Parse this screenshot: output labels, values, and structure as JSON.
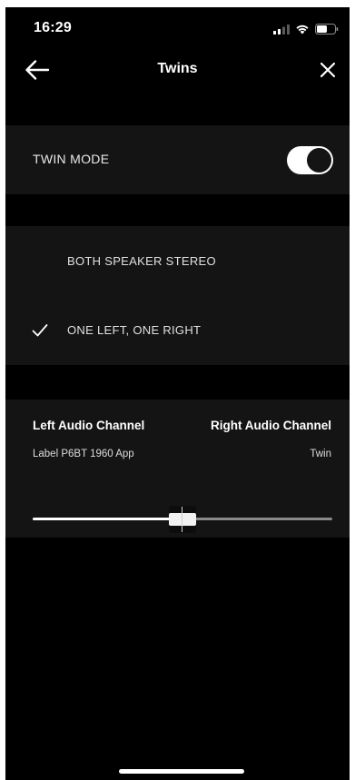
{
  "status_bar": {
    "time": "16:29",
    "icons": [
      "signal-icon",
      "wifi-icon",
      "battery-icon"
    ]
  },
  "nav": {
    "title": "Twins",
    "back_icon": "arrow-left-icon",
    "close_icon": "close-icon"
  },
  "twin_mode": {
    "label": "TWIN MODE",
    "enabled": true
  },
  "modes": {
    "options": [
      {
        "label": "BOTH SPEAKER STEREO",
        "selected": false
      },
      {
        "label": "ONE LEFT, ONE RIGHT",
        "selected": true
      }
    ]
  },
  "audio_channel": {
    "left_title": "Left Audio Channel",
    "right_title": "Right Audio Channel",
    "left_device": "Label P6BT 1960 App",
    "right_device": "Twin",
    "balance_fraction": 0.5
  },
  "colors": {
    "background": "#000000",
    "section": "#141414",
    "text": "#ffffff",
    "track": "#8a8a8a"
  }
}
